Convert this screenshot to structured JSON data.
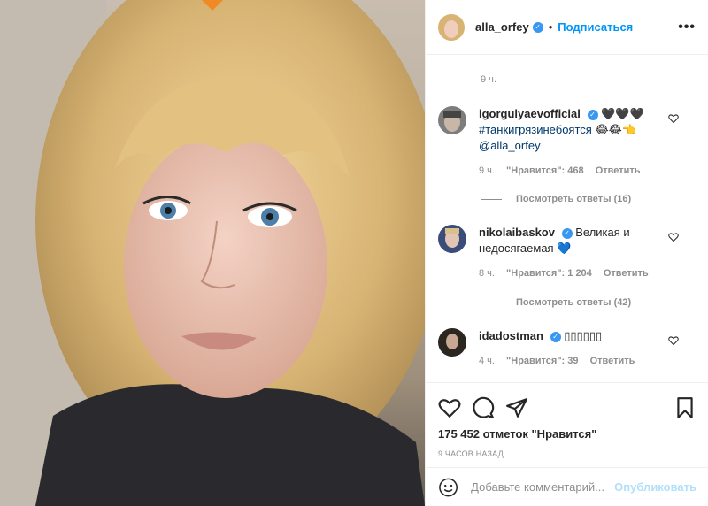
{
  "photo": {
    "alt_icon": "post-photo"
  },
  "header": {
    "username": "alla_orfey",
    "verified_icon": "verified-badge-icon",
    "separator": "•",
    "follow_label": "Подписаться",
    "more_icon": "more-options-icon"
  },
  "caption": {
    "time": "9 ч."
  },
  "comments": [
    {
      "username": "igorgulyaevofficial",
      "text_1": "🖤🖤🖤",
      "hashtag": "#танкигрязинебоятся",
      "text_2": "😂😂👈",
      "mention": "@alla_orfey",
      "time": "9 ч.",
      "likes": "\"Нравится\": 468",
      "reply": "Ответить",
      "view_replies": "Посмотреть ответы (16)"
    },
    {
      "username": "nikolaibaskov",
      "text": "Великая и недосягаемая 💙",
      "time": "8 ч.",
      "likes": "\"Нравится\": 1 204",
      "reply": "Ответить",
      "view_replies": "Посмотреть ответы (42)"
    },
    {
      "username": "idadostman",
      "text": "▯▯▯▯▯▯",
      "time": "4 ч.",
      "likes": "\"Нравится\": 39",
      "reply": "Ответить"
    }
  ],
  "actions": {
    "like_icon": "heart-icon",
    "comment_icon": "comment-icon",
    "share_icon": "share-icon",
    "save_icon": "bookmark-icon",
    "likes_count": "175 452 отметок \"Нравится\"",
    "posted": "9 ЧАСОВ НАЗАД"
  },
  "add_comment": {
    "placeholder": "Добавьте комментарий...",
    "publish_label": "Опубликовать",
    "emoji_icon": "emoji-icon"
  }
}
